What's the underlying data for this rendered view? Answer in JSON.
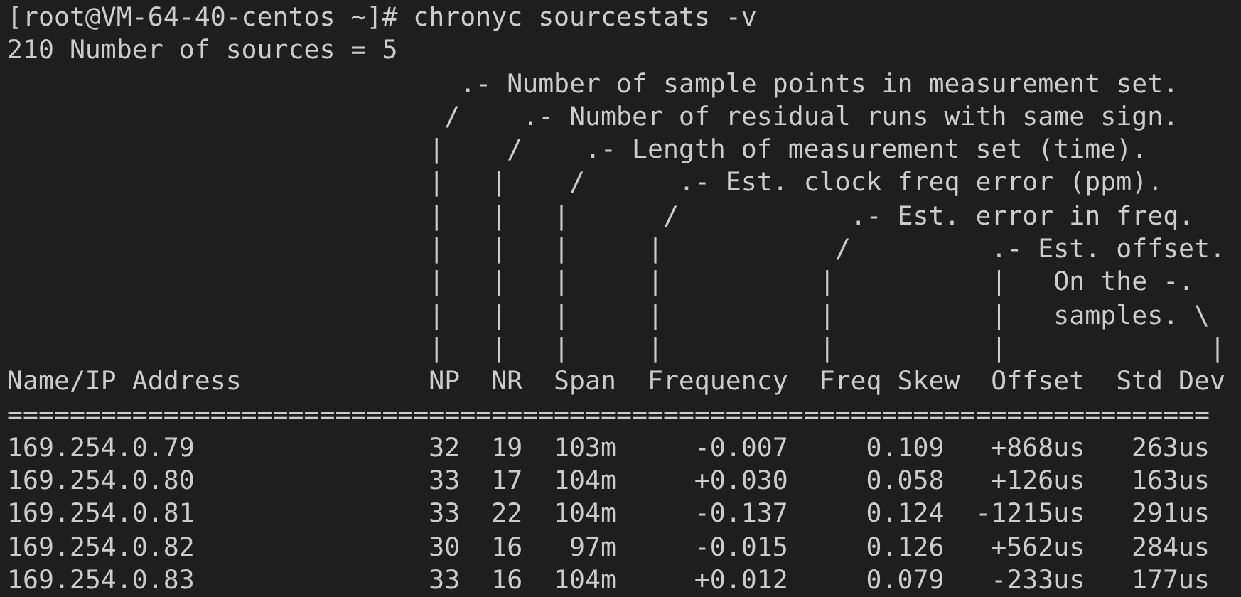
{
  "prompt_line": "[root@VM-64-40-centos ~]# chronyc sourcestats -v",
  "summary_line": "210 Number of sources = 5",
  "legend_lines": [
    "                             .- Number of sample points in measurement set.",
    "                            /    .- Number of residual runs with same sign.",
    "                           |    /    .- Length of measurement set (time).",
    "                           |   |    /      .- Est. clock freq error (ppm).",
    "                           |   |   |      /           .- Est. error in freq.",
    "                           |   |   |     |           /         .- Est. offset.",
    "                           |   |   |     |          |          |   On the -.",
    "                           |   |   |     |          |          |   samples. \\",
    "                           |   |   |     |          |          |             |"
  ],
  "table": {
    "columns": [
      "Name/IP Address",
      "NP",
      "NR",
      "Span",
      "Frequency",
      "Freq Skew",
      "Offset",
      "Std Dev"
    ],
    "separator": "=============================================================================",
    "rows": [
      [
        "169.254.0.79",
        "32",
        "19",
        "103m",
        "-0.007",
        "0.109",
        "+868us",
        "263us"
      ],
      [
        "169.254.0.80",
        "33",
        "17",
        "104m",
        "+0.030",
        "0.058",
        "+126us",
        "163us"
      ],
      [
        "169.254.0.81",
        "33",
        "22",
        "104m",
        "-0.137",
        "0.124",
        "-1215us",
        "291us"
      ],
      [
        "169.254.0.82",
        "30",
        "16",
        "97m",
        "-0.015",
        "0.126",
        "+562us",
        "284us"
      ],
      [
        "169.254.0.83",
        "33",
        "16",
        "104m",
        "+0.012",
        "0.079",
        "-233us",
        "177us"
      ]
    ]
  }
}
